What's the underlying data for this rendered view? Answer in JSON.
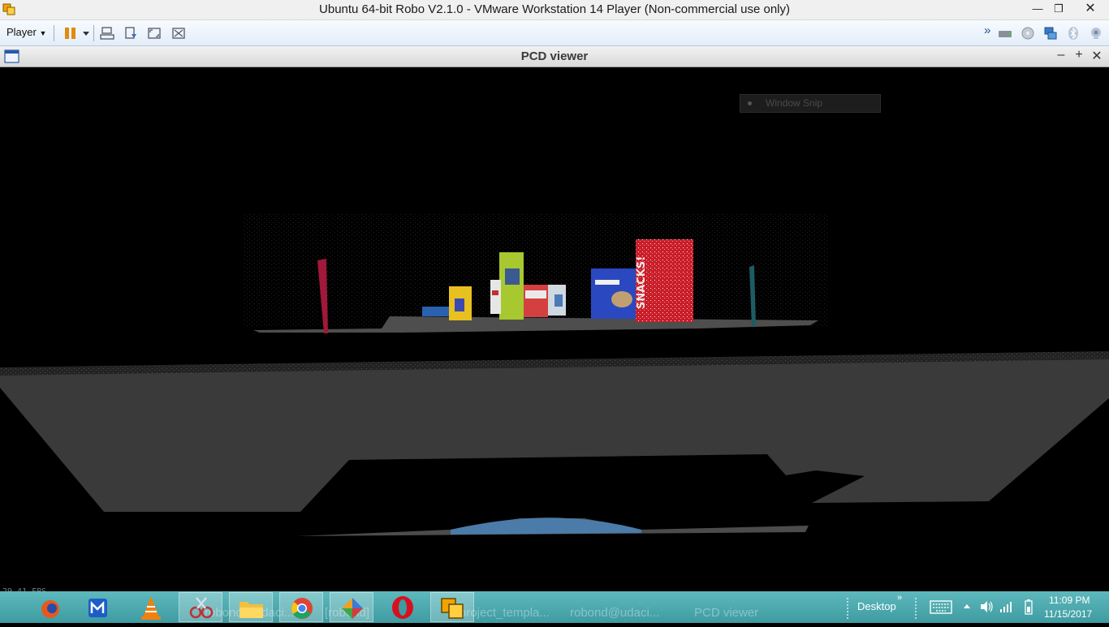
{
  "vm": {
    "title": "Ubuntu 64-bit Robo V2.1.0 - VMware Workstation 14 Player (Non-commercial use only)",
    "player_label": "Player"
  },
  "pcd": {
    "title": "PCD viewer"
  },
  "viewer": {
    "popup_label": "Window Snip",
    "fps_text": "29.41 FPS"
  },
  "taskbar": {
    "ghost_windows": [
      "robond@udaci...",
      "[robond]",
      "project_templa...",
      "robond@udaci...",
      "PCD viewer"
    ],
    "desktop_label": "Desktop",
    "chevron": "»",
    "time": "11:09 PM",
    "date": "11/15/2017"
  },
  "colors": {
    "taskbar": "#3e9ba1",
    "table": "#4a4a4a",
    "floor": "#3a3a3a"
  }
}
